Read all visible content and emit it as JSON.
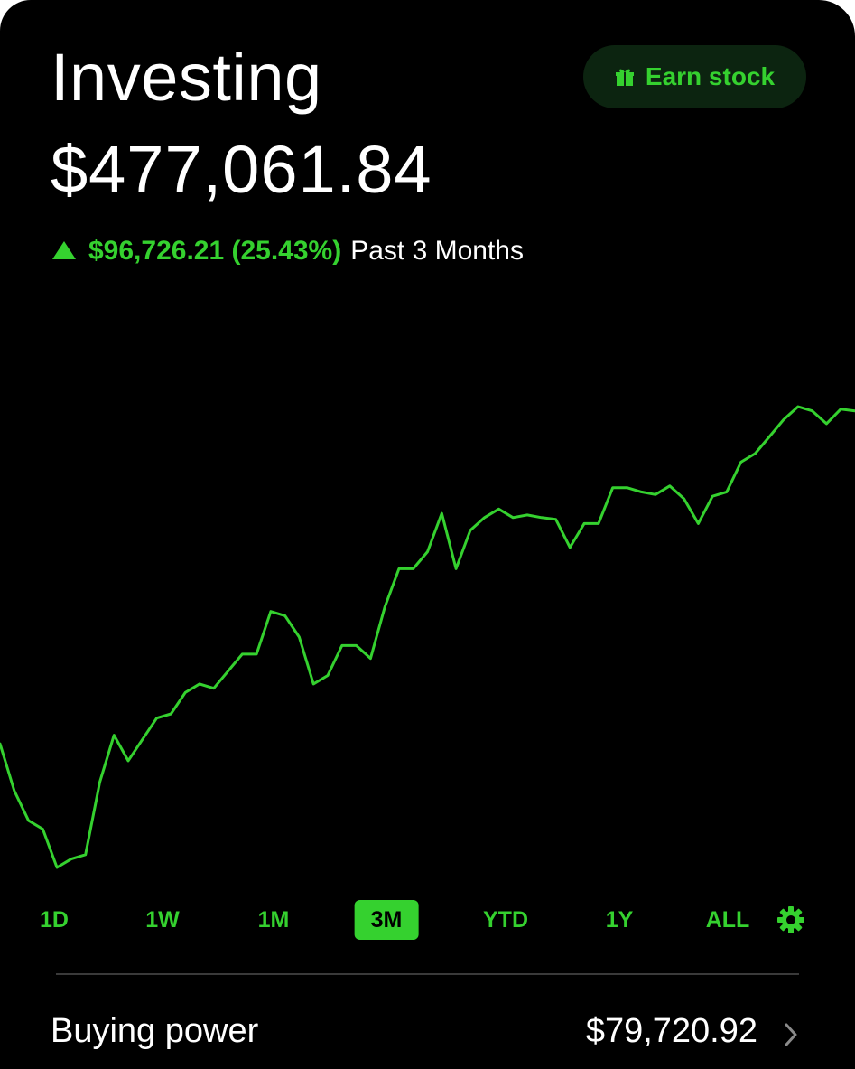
{
  "header": {
    "title": "Investing",
    "portfolio_value": "$477,061.84",
    "change_amount": "$96,726.21 (25.43%)",
    "change_period": "Past 3 Months",
    "earn_label": "Earn stock"
  },
  "colors": {
    "accent": "#35d12f",
    "background": "#000000",
    "text": "#ffffff",
    "earn_button_bg": "#0c2410"
  },
  "chart_data": {
    "type": "line",
    "values": [
      394.0,
      388.5,
      385.0,
      384.0,
      379.5,
      380.5,
      381.0,
      389.5,
      395.0,
      392.0,
      394.5,
      397.0,
      397.5,
      400.0,
      401.0,
      400.5,
      402.5,
      404.5,
      404.5,
      409.5,
      409.0,
      406.5,
      401.0,
      402.0,
      405.5,
      405.5,
      404.0,
      410.0,
      414.5,
      414.5,
      416.5,
      421.0,
      414.5,
      419.0,
      420.5,
      421.5,
      420.5,
      420.8,
      420.5,
      420.3,
      417.0,
      419.8,
      419.8,
      424.0,
      424.0,
      423.5,
      423.2,
      424.2,
      422.7,
      419.8,
      423.0,
      423.5,
      427.0,
      428.0,
      430.0,
      432.0,
      433.5,
      433.0,
      431.5,
      433.2,
      433.0
    ],
    "color": "#35d12f"
  },
  "range_tabs": [
    {
      "label": "1D",
      "active": false
    },
    {
      "label": "1W",
      "active": false
    },
    {
      "label": "1M",
      "active": false
    },
    {
      "label": "3M",
      "active": true
    },
    {
      "label": "YTD",
      "active": false
    },
    {
      "label": "1Y",
      "active": false
    },
    {
      "label": "ALL",
      "active": false
    }
  ],
  "buying_power": {
    "label": "Buying power",
    "value": "$79,720.92"
  },
  "icons": {
    "earn": "gift-icon",
    "change": "triangle-up-icon",
    "settings": "gear-icon",
    "row": "chevron-right-icon"
  }
}
